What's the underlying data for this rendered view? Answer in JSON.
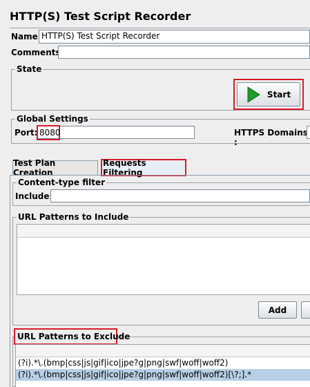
{
  "window": {
    "title": "HTTP(S) Test Script Recorder"
  },
  "name_field": {
    "label": "Name:",
    "value": "HTTP(S) Test Script Recorder"
  },
  "comments_field": {
    "label": "Comments:"
  },
  "state": {
    "legend": "State",
    "start_label": "Start"
  },
  "global_settings": {
    "legend": "Global Settings",
    "port_label": "Port:",
    "port_value": "8080",
    "https_domains_label": "HTTPS Domains :"
  },
  "tabs": [
    {
      "label": "Test Plan Creation"
    },
    {
      "label": "Requests Filtering"
    }
  ],
  "content_type_filter": {
    "legend": "Content-type filter",
    "include_label": "Include:"
  },
  "url_include": {
    "legend": "URL Patterns to Include",
    "add_label": "Add"
  },
  "url_exclude": {
    "legend": "URL Patterns to Exclude",
    "rows": [
      "(?i).*\\.(bmp|css|js|gif|ico|jpe?g|png|swf|woff|woff2)",
      "(?i).*\\.(bmp|css|js|gif|ico|jpe?g|png|swf|woff|woff2)[\\?;].*"
    ]
  },
  "colors": {
    "highlight": "#d71a2a",
    "selection": "#b8cfe5",
    "start_icon": "#1f9a2a"
  }
}
